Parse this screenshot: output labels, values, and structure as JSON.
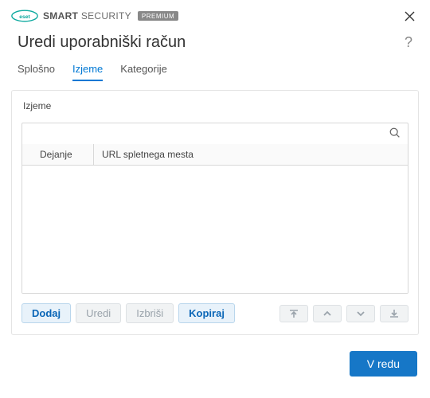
{
  "brand": {
    "name": "SMART SECURITY",
    "prefix_bold": "SMART",
    "suffix": "SECURITY",
    "badge": "PREMIUM"
  },
  "dialog": {
    "title": "Uredi uporabniški račun"
  },
  "tabs": {
    "general": "Splošno",
    "exceptions": "Izjeme",
    "categories": "Kategorije",
    "active_index": 1
  },
  "section": {
    "label": "Izjeme"
  },
  "table": {
    "col_action": "Dejanje",
    "col_url": "URL spletnega mesta",
    "rows": []
  },
  "buttons": {
    "add": "Dodaj",
    "edit": "Uredi",
    "delete": "Izbriši",
    "copy": "Kopiraj",
    "ok": "V redu"
  }
}
